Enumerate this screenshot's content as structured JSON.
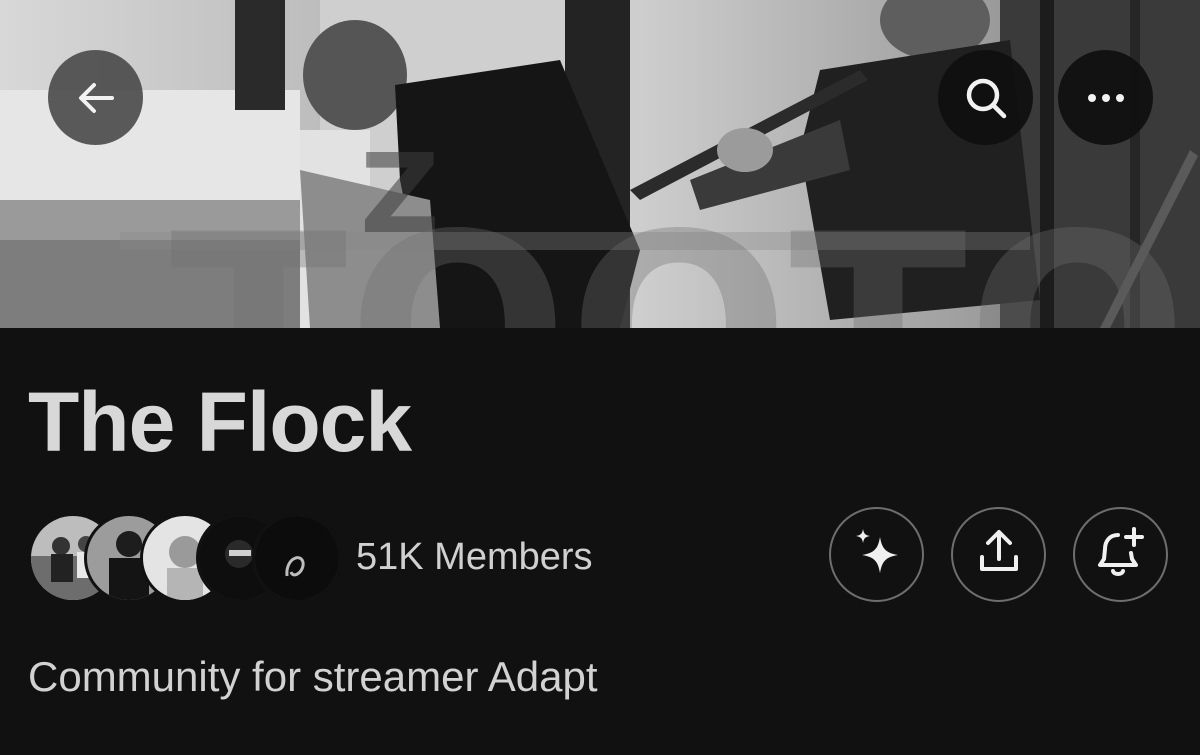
{
  "header": {
    "back_icon": "arrow-left-icon",
    "search_icon": "search-icon",
    "more_icon": "more-horizontal-icon"
  },
  "community": {
    "name": "The Flock",
    "members_label": "51K Members",
    "description": "Community for streamer Adapt",
    "member_avatar_count": 5
  },
  "actions": {
    "grok_icon": "sparkle-icon",
    "share_icon": "share-upload-icon",
    "notify_icon": "bell-plus-icon"
  },
  "colors": {
    "background": "#111111",
    "text_primary": "#d8d8d8",
    "button_border": "#6e6e6e"
  }
}
